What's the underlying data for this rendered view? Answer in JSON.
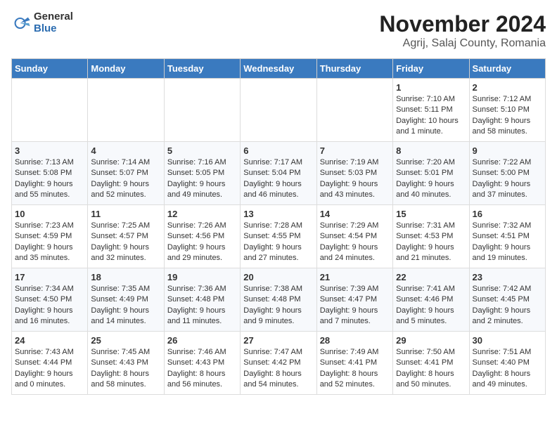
{
  "logo": {
    "general": "General",
    "blue": "Blue"
  },
  "title": "November 2024",
  "subtitle": "Agrij, Salaj County, Romania",
  "days_of_week": [
    "Sunday",
    "Monday",
    "Tuesday",
    "Wednesday",
    "Thursday",
    "Friday",
    "Saturday"
  ],
  "weeks": [
    [
      {
        "day": "",
        "detail": ""
      },
      {
        "day": "",
        "detail": ""
      },
      {
        "day": "",
        "detail": ""
      },
      {
        "day": "",
        "detail": ""
      },
      {
        "day": "",
        "detail": ""
      },
      {
        "day": "1",
        "detail": "Sunrise: 7:10 AM\nSunset: 5:11 PM\nDaylight: 10 hours and 1 minute."
      },
      {
        "day": "2",
        "detail": "Sunrise: 7:12 AM\nSunset: 5:10 PM\nDaylight: 9 hours and 58 minutes."
      }
    ],
    [
      {
        "day": "3",
        "detail": "Sunrise: 7:13 AM\nSunset: 5:08 PM\nDaylight: 9 hours and 55 minutes."
      },
      {
        "day": "4",
        "detail": "Sunrise: 7:14 AM\nSunset: 5:07 PM\nDaylight: 9 hours and 52 minutes."
      },
      {
        "day": "5",
        "detail": "Sunrise: 7:16 AM\nSunset: 5:05 PM\nDaylight: 9 hours and 49 minutes."
      },
      {
        "day": "6",
        "detail": "Sunrise: 7:17 AM\nSunset: 5:04 PM\nDaylight: 9 hours and 46 minutes."
      },
      {
        "day": "7",
        "detail": "Sunrise: 7:19 AM\nSunset: 5:03 PM\nDaylight: 9 hours and 43 minutes."
      },
      {
        "day": "8",
        "detail": "Sunrise: 7:20 AM\nSunset: 5:01 PM\nDaylight: 9 hours and 40 minutes."
      },
      {
        "day": "9",
        "detail": "Sunrise: 7:22 AM\nSunset: 5:00 PM\nDaylight: 9 hours and 37 minutes."
      }
    ],
    [
      {
        "day": "10",
        "detail": "Sunrise: 7:23 AM\nSunset: 4:59 PM\nDaylight: 9 hours and 35 minutes."
      },
      {
        "day": "11",
        "detail": "Sunrise: 7:25 AM\nSunset: 4:57 PM\nDaylight: 9 hours and 32 minutes."
      },
      {
        "day": "12",
        "detail": "Sunrise: 7:26 AM\nSunset: 4:56 PM\nDaylight: 9 hours and 29 minutes."
      },
      {
        "day": "13",
        "detail": "Sunrise: 7:28 AM\nSunset: 4:55 PM\nDaylight: 9 hours and 27 minutes."
      },
      {
        "day": "14",
        "detail": "Sunrise: 7:29 AM\nSunset: 4:54 PM\nDaylight: 9 hours and 24 minutes."
      },
      {
        "day": "15",
        "detail": "Sunrise: 7:31 AM\nSunset: 4:53 PM\nDaylight: 9 hours and 21 minutes."
      },
      {
        "day": "16",
        "detail": "Sunrise: 7:32 AM\nSunset: 4:51 PM\nDaylight: 9 hours and 19 minutes."
      }
    ],
    [
      {
        "day": "17",
        "detail": "Sunrise: 7:34 AM\nSunset: 4:50 PM\nDaylight: 9 hours and 16 minutes."
      },
      {
        "day": "18",
        "detail": "Sunrise: 7:35 AM\nSunset: 4:49 PM\nDaylight: 9 hours and 14 minutes."
      },
      {
        "day": "19",
        "detail": "Sunrise: 7:36 AM\nSunset: 4:48 PM\nDaylight: 9 hours and 11 minutes."
      },
      {
        "day": "20",
        "detail": "Sunrise: 7:38 AM\nSunset: 4:48 PM\nDaylight: 9 hours and 9 minutes."
      },
      {
        "day": "21",
        "detail": "Sunrise: 7:39 AM\nSunset: 4:47 PM\nDaylight: 9 hours and 7 minutes."
      },
      {
        "day": "22",
        "detail": "Sunrise: 7:41 AM\nSunset: 4:46 PM\nDaylight: 9 hours and 5 minutes."
      },
      {
        "day": "23",
        "detail": "Sunrise: 7:42 AM\nSunset: 4:45 PM\nDaylight: 9 hours and 2 minutes."
      }
    ],
    [
      {
        "day": "24",
        "detail": "Sunrise: 7:43 AM\nSunset: 4:44 PM\nDaylight: 9 hours and 0 minutes."
      },
      {
        "day": "25",
        "detail": "Sunrise: 7:45 AM\nSunset: 4:43 PM\nDaylight: 8 hours and 58 minutes."
      },
      {
        "day": "26",
        "detail": "Sunrise: 7:46 AM\nSunset: 4:43 PM\nDaylight: 8 hours and 56 minutes."
      },
      {
        "day": "27",
        "detail": "Sunrise: 7:47 AM\nSunset: 4:42 PM\nDaylight: 8 hours and 54 minutes."
      },
      {
        "day": "28",
        "detail": "Sunrise: 7:49 AM\nSunset: 4:41 PM\nDaylight: 8 hours and 52 minutes."
      },
      {
        "day": "29",
        "detail": "Sunrise: 7:50 AM\nSunset: 4:41 PM\nDaylight: 8 hours and 50 minutes."
      },
      {
        "day": "30",
        "detail": "Sunrise: 7:51 AM\nSunset: 4:40 PM\nDaylight: 8 hours and 49 minutes."
      }
    ]
  ]
}
